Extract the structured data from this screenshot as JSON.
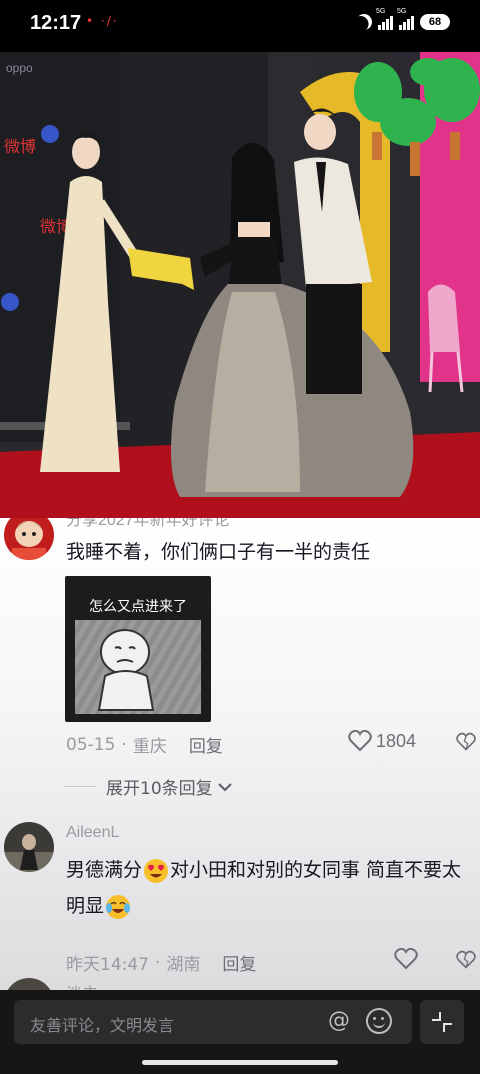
{
  "status_bar": {
    "time": "12:17",
    "dots": "• ·/·",
    "network1": "5G",
    "network2": "5G",
    "battery": "68"
  },
  "video": {
    "description_icons": [
      "moon-icon"
    ]
  },
  "comments": [
    {
      "username": "分享2027年新年好评论",
      "text": "我睡不着，你们俩口子有一半的责任",
      "sticker_caption": "怎么又点进来了",
      "date": "05-15",
      "location": "重庆",
      "reply_label": "回复",
      "likes": "1804",
      "expand_label": "展开10条回复"
    },
    {
      "username": "AileenL",
      "text_part1": "男德满分",
      "text_part2": "对小田和对别的女同事 简直不要太明显",
      "date": "昨天14:47",
      "location": "湖南",
      "reply_label": "回复",
      "likes": ""
    },
    {
      "username": "淡去"
    }
  ],
  "input_bar": {
    "placeholder": "友善评论，文明发言"
  },
  "colors": {
    "red_carpet": "#b0101c",
    "sheet_bg": "#ffffff",
    "text_primary": "#161823",
    "text_secondary": "#9a9aa0"
  }
}
